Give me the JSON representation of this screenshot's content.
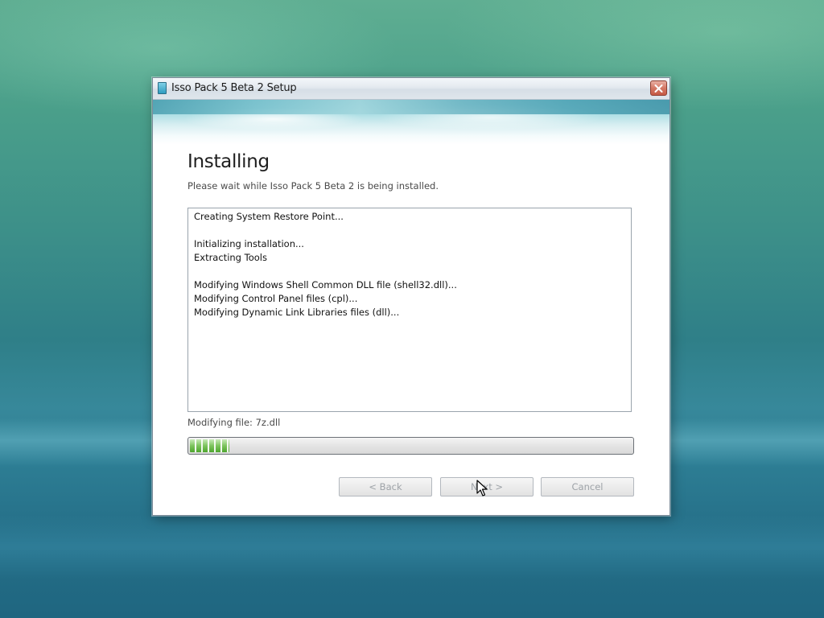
{
  "window": {
    "title": "Isso Pack 5 Beta 2 Setup",
    "icon": "installer-icon",
    "close_icon": "close-icon"
  },
  "page": {
    "heading": "Installing",
    "subheading": "Please wait while Isso Pack 5 Beta 2 is being installed."
  },
  "log": {
    "lines": [
      "Creating System Restore Point...",
      "",
      "Initializing installation...",
      "Extracting Tools",
      "",
      "Modifying Windows Shell Common DLL file (shell32.dll)...",
      "Modifying Control Panel files (cpl)...",
      "Modifying Dynamic Link Libraries files (dll)..."
    ]
  },
  "status": {
    "current_action": "Modifying file: 7z.dll",
    "progress_fraction": 0.09
  },
  "buttons": {
    "back_label": "< Back",
    "next_label": "Next >",
    "cancel_label": "Cancel",
    "back_enabled": false,
    "next_enabled": false,
    "cancel_enabled": false
  },
  "colors": {
    "progress_fill": "#4ea52e",
    "disabled_text": "#9ea3a8",
    "close_button": "#c65a45"
  }
}
